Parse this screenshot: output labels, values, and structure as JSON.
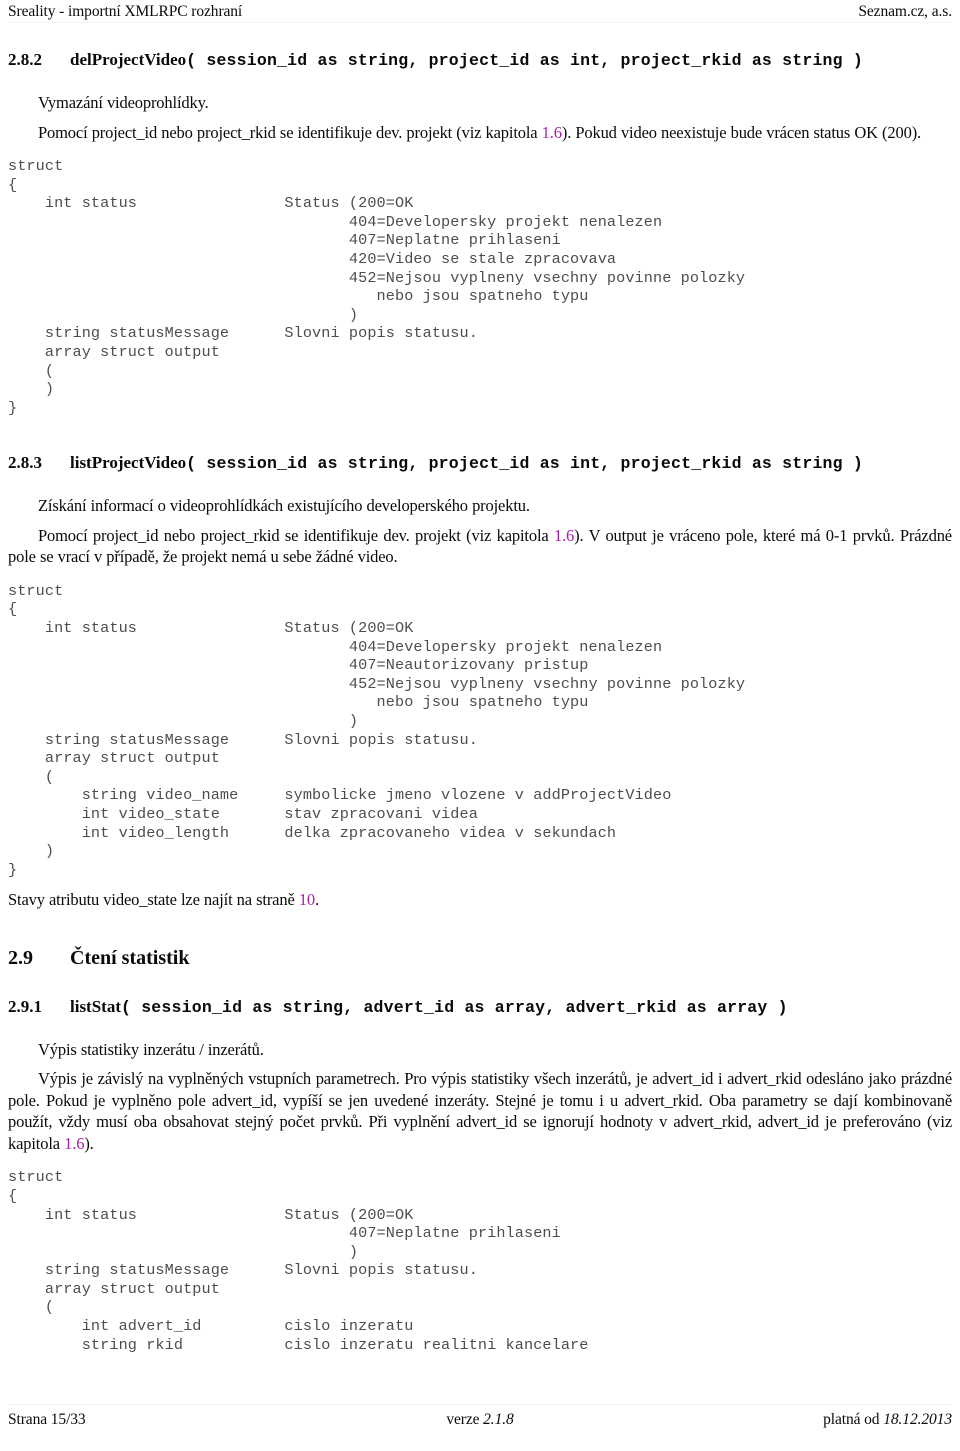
{
  "header": {
    "left": "Sreality - importní XMLRPC rozhraní",
    "right": "Seznam.cz, a.s."
  },
  "footer": {
    "page": "Strana 15/33",
    "version_label": "verze ",
    "version": "2.1.8",
    "valid_label": "platná od ",
    "valid_from": "18.12.2013"
  },
  "sections": [
    {
      "number": "2.8.2",
      "name": "delProjectVideo",
      "signature": "( session_id as string, project_id as int, project_rkid as string )",
      "p1": "Vymazání videoprohlídky.",
      "p2_a": "Pomocí project_id nebo project_rkid se identifikuje dev. projekt (viz kapitola ",
      "p2_link": "1.6",
      "p2_b": "). Pokud video neexistuje bude vrácen status OK (200).",
      "code": "struct\n{\n    int status                Status (200=OK\n                                     404=Developersky projekt nenalezen\n                                     407=Neplatne prihlaseni\n                                     420=Video se stale zpracovava\n                                     452=Nejsou vyplneny vsechny povinne polozky\n                                        nebo jsou spatneho typu\n                                     )\n    string statusMessage      Slovni popis statusu.\n    array struct output\n    (\n    )\n}"
    },
    {
      "number": "2.8.3",
      "name": "listProjectVideo",
      "signature": "( session_id as string, project_id as int, project_rkid as string )",
      "p1": "Získání informací o videoprohlídkách existujícího developerského projektu.",
      "p2_a": "Pomocí project_id nebo project_rkid se identifikuje dev. projekt (viz kapitola ",
      "p2_link": "1.6",
      "p2_b": "). V output je vráceno pole, které má 0-1 prvků. Prázdné pole se vrací v případě, že projekt nemá u sebe žádné video.",
      "code": "struct\n{\n    int status                Status (200=OK\n                                     404=Developersky projekt nenalezen\n                                     407=Neautorizovany pristup\n                                     452=Nejsou vyplneny vsechny povinne polozky\n                                        nebo jsou spatneho typu\n                                     )\n    string statusMessage      Slovni popis statusu.\n    array struct output\n    (\n        string video_name     symbolicke jmeno vlozene v addProjectVideo\n        int video_state       stav zpracovani videa\n        int video_length      delka zpracovaneho videa v sekundach\n    )\n}",
      "p3_a": "Stavy atributu video_state lze najít na straně ",
      "p3_link": "10",
      "p3_b": "."
    }
  ],
  "chapter": {
    "number": "2.9",
    "title": "Čtení statistik"
  },
  "section291": {
    "number": "2.9.1",
    "name": "listStat",
    "signature": "( session_id as string, advert_id as array, advert_rkid as array )",
    "p1": "Výpis statistiky inzerátu / inzerátů.",
    "p2_a": "Výpis je závislý na vyplněných vstupních parametrech. Pro výpis statistiky všech inzerátů, je advert_id i advert_rkid odesláno jako prázdné pole. Pokud je vyplněno pole advert_id, vypíší se jen uvedené inzeráty. Stejné je tomu i u advert_rkid. Oba parametry se dají kombinovaně použít, vždy musí oba obsahovat stejný počet prvků. Při vyplnění advert_id se ignorují hodnoty v advert_rkid, advert_id je preferováno (viz kapitola ",
    "p2_link": "1.6",
    "p2_b": ").",
    "code": "struct\n{\n    int status                Status (200=OK\n                                     407=Neplatne prihlaseni\n                                     )\n    string statusMessage      Slovni popis statusu.\n    array struct output\n    (\n        int advert_id         cislo inzeratu\n        string rkid           cislo inzeratu realitni kancelare"
  },
  "colors": {
    "link": "#a521a5",
    "code_text": "#4d4d4d",
    "body_text": "#0a0a0a"
  }
}
